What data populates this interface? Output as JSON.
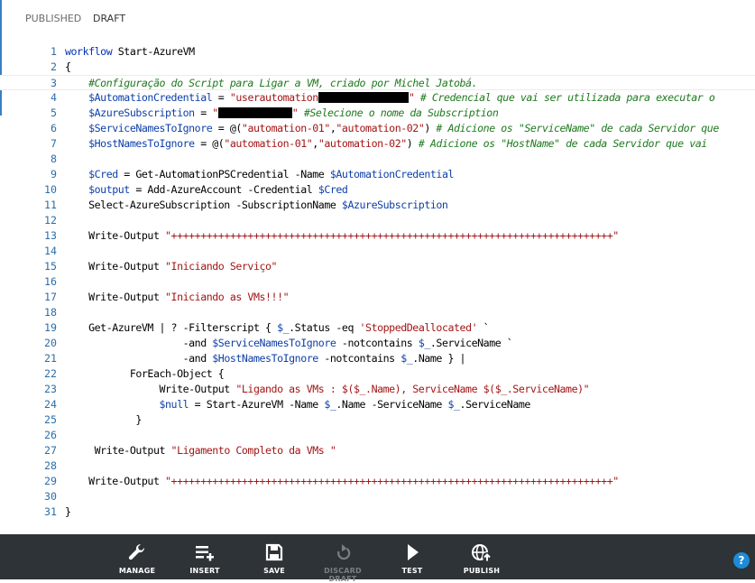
{
  "tabs": [
    {
      "label": "PUBLISHED"
    },
    {
      "label": "DRAFT"
    }
  ],
  "editor": {
    "lines": [
      {
        "n": "1",
        "tokens": [
          {
            "t": "kw",
            "v": "workflow"
          },
          {
            "t": "p",
            "v": " Start-AzureVM"
          }
        ]
      },
      {
        "n": "2",
        "tokens": [
          {
            "t": "p",
            "v": "{"
          }
        ]
      },
      {
        "n": "3",
        "tokens": [
          {
            "t": "p",
            "v": "    "
          },
          {
            "t": "cm",
            "v": "#Configuração do Script para Ligar a VM, criado por Michel Jatobá."
          }
        ]
      },
      {
        "n": "4",
        "tokens": [
          {
            "t": "p",
            "v": "    "
          },
          {
            "t": "var",
            "v": "$AutomationCredential"
          },
          {
            "t": "p",
            "v": " = "
          },
          {
            "t": "str",
            "v": "\"userautomation"
          },
          {
            "t": "redact",
            "v": "",
            "w": 100
          },
          {
            "t": "str",
            "v": "\""
          },
          {
            "t": "cm",
            "v": " # Credencial que vai ser utilizada para executar o"
          }
        ]
      },
      {
        "n": "5",
        "tokens": [
          {
            "t": "p",
            "v": "    "
          },
          {
            "t": "var",
            "v": "$AzureSubscription"
          },
          {
            "t": "p",
            "v": " = "
          },
          {
            "t": "str",
            "v": "\""
          },
          {
            "t": "redact",
            "v": "",
            "w": 82
          },
          {
            "t": "str",
            "v": "\""
          },
          {
            "t": "cm",
            "v": " #Selecione o nome da Subscription"
          }
        ]
      },
      {
        "n": "6",
        "tokens": [
          {
            "t": "p",
            "v": "    "
          },
          {
            "t": "var",
            "v": "$ServiceNamesToIgnore"
          },
          {
            "t": "p",
            "v": " = @("
          },
          {
            "t": "str",
            "v": "\"automation-01\""
          },
          {
            "t": "p",
            "v": ","
          },
          {
            "t": "str",
            "v": "\"automation-02\""
          },
          {
            "t": "p",
            "v": ")"
          },
          {
            "t": "cm",
            "v": " # Adicione os \"ServiceName\" de cada Servidor que"
          }
        ]
      },
      {
        "n": "7",
        "tokens": [
          {
            "t": "p",
            "v": "    "
          },
          {
            "t": "var",
            "v": "$HostNamesToIgnore"
          },
          {
            "t": "p",
            "v": " = @("
          },
          {
            "t": "str",
            "v": "\"automation-01\""
          },
          {
            "t": "p",
            "v": ","
          },
          {
            "t": "str",
            "v": "\"automation-02\""
          },
          {
            "t": "p",
            "v": ")"
          },
          {
            "t": "cm",
            "v": " # Adicione os \"HostName\" de cada Servidor que vai"
          }
        ]
      },
      {
        "n": "8",
        "tokens": []
      },
      {
        "n": "9",
        "tokens": [
          {
            "t": "p",
            "v": "    "
          },
          {
            "t": "var",
            "v": "$Cred"
          },
          {
            "t": "p",
            "v": " = Get-AutomationPSCredential -Name "
          },
          {
            "t": "var",
            "v": "$AutomationCredential"
          }
        ]
      },
      {
        "n": "10",
        "tokens": [
          {
            "t": "p",
            "v": "    "
          },
          {
            "t": "var",
            "v": "$output"
          },
          {
            "t": "p",
            "v": " = Add-AzureAccount -Credential "
          },
          {
            "t": "var",
            "v": "$Cred"
          }
        ]
      },
      {
        "n": "11",
        "tokens": [
          {
            "t": "p",
            "v": "    Select-AzureSubscription -SubscriptionName "
          },
          {
            "t": "var",
            "v": "$AzureSubscription"
          }
        ]
      },
      {
        "n": "12",
        "tokens": []
      },
      {
        "n": "13",
        "tokens": [
          {
            "t": "p",
            "v": "    Write-Output "
          },
          {
            "t": "str",
            "v": "\"+++++++++++++++++++++++++++++++++++++++++++++++++++++++++++++++++++++++++++\""
          }
        ]
      },
      {
        "n": "14",
        "tokens": []
      },
      {
        "n": "15",
        "tokens": [
          {
            "t": "p",
            "v": "    Write-Output "
          },
          {
            "t": "str",
            "v": "\"Iniciando Serviço\""
          }
        ]
      },
      {
        "n": "16",
        "tokens": []
      },
      {
        "n": "17",
        "tokens": [
          {
            "t": "p",
            "v": "    Write-Output "
          },
          {
            "t": "str",
            "v": "\"Iniciando as VMs!!!\""
          }
        ]
      },
      {
        "n": "18",
        "tokens": []
      },
      {
        "n": "19",
        "tokens": [
          {
            "t": "p",
            "v": "    Get-AzureVM | ? -Filterscript { "
          },
          {
            "t": "var",
            "v": "$_"
          },
          {
            "t": "p",
            "v": ".Status -eq "
          },
          {
            "t": "str",
            "v": "'StoppedDeallocated'"
          },
          {
            "t": "p",
            "v": " `"
          }
        ]
      },
      {
        "n": "20",
        "tokens": [
          {
            "t": "p",
            "v": "                    -and "
          },
          {
            "t": "var",
            "v": "$ServiceNamesToIgnore"
          },
          {
            "t": "p",
            "v": " -notcontains "
          },
          {
            "t": "var",
            "v": "$_"
          },
          {
            "t": "p",
            "v": ".ServiceName `"
          }
        ]
      },
      {
        "n": "21",
        "tokens": [
          {
            "t": "p",
            "v": "                    -and "
          },
          {
            "t": "var",
            "v": "$HostNamesToIgnore"
          },
          {
            "t": "p",
            "v": " -notcontains "
          },
          {
            "t": "var",
            "v": "$_"
          },
          {
            "t": "p",
            "v": ".Name } |"
          }
        ]
      },
      {
        "n": "22",
        "tokens": [
          {
            "t": "p",
            "v": "           ForEach-Object {"
          }
        ]
      },
      {
        "n": "23",
        "tokens": [
          {
            "t": "p",
            "v": "                Write-Output "
          },
          {
            "t": "str",
            "v": "\"Ligando as VMs : $($_.Name), ServiceName $($_.ServiceName)\""
          }
        ]
      },
      {
        "n": "24",
        "tokens": [
          {
            "t": "p",
            "v": "                "
          },
          {
            "t": "var",
            "v": "$null"
          },
          {
            "t": "p",
            "v": " = Start-AzureVM -Name "
          },
          {
            "t": "var",
            "v": "$_"
          },
          {
            "t": "p",
            "v": ".Name -ServiceName "
          },
          {
            "t": "var",
            "v": "$_"
          },
          {
            "t": "p",
            "v": ".ServiceName"
          }
        ]
      },
      {
        "n": "25",
        "tokens": [
          {
            "t": "p",
            "v": "            }"
          }
        ]
      },
      {
        "n": "26",
        "tokens": []
      },
      {
        "n": "27",
        "tokens": [
          {
            "t": "p",
            "v": "     Write-Output "
          },
          {
            "t": "str",
            "v": "\"Ligamento Completo da VMs \""
          }
        ]
      },
      {
        "n": "28",
        "tokens": []
      },
      {
        "n": "29",
        "tokens": [
          {
            "t": "p",
            "v": "    Write-Output "
          },
          {
            "t": "str",
            "v": "\"+++++++++++++++++++++++++++++++++++++++++++++++++++++++++++++++++++++++++++\""
          }
        ]
      },
      {
        "n": "30",
        "tokens": []
      },
      {
        "n": "31",
        "tokens": [
          {
            "t": "p",
            "v": "}"
          }
        ]
      }
    ],
    "current_line": 3
  },
  "toolbar": {
    "buttons": [
      {
        "label": "MANAGE",
        "icon": "wrench-icon",
        "enabled": true
      },
      {
        "label": "INSERT",
        "icon": "insert-list-icon",
        "enabled": true
      },
      {
        "label": "SAVE",
        "icon": "save-disk-icon",
        "enabled": true
      },
      {
        "label": "DISCARD DRAFT",
        "icon": "undo-icon",
        "enabled": false
      },
      {
        "label": "TEST",
        "icon": "play-icon",
        "enabled": true
      },
      {
        "label": "PUBLISH",
        "icon": "publish-globe-icon",
        "enabled": true
      }
    ]
  },
  "help": {
    "label": "?",
    "icon": "help-icon"
  },
  "colors": {
    "toolbar_bg": "#2e3338",
    "help": "#1e8bd8",
    "line_number": "#2b6ea8",
    "string": "#a31515",
    "comment": "#1f7a1f",
    "keyword": "#0033b3"
  }
}
